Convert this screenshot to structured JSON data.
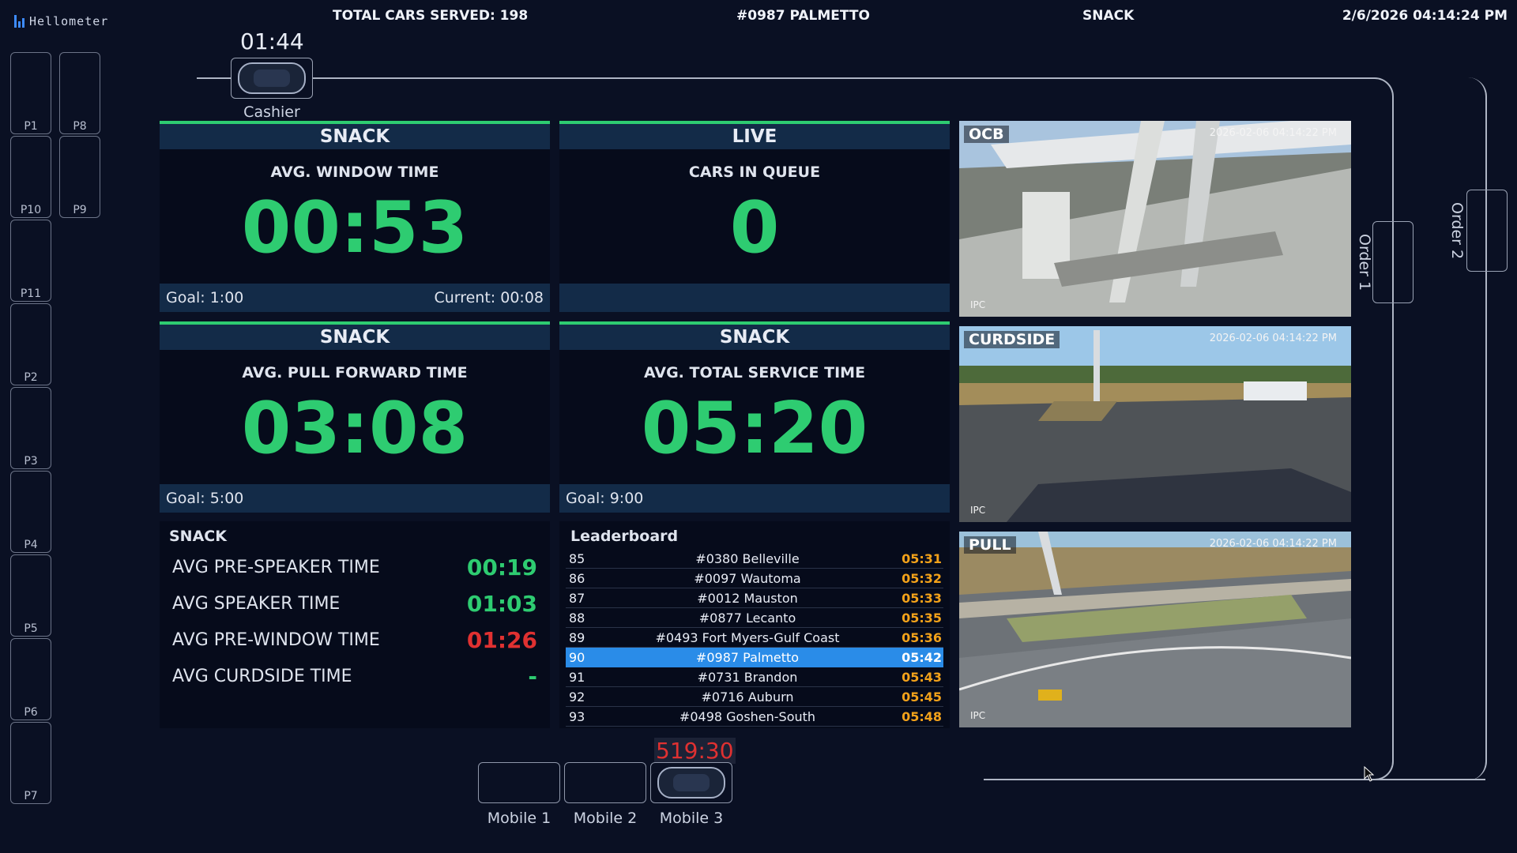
{
  "brand": "Hellometer",
  "header": {
    "total_cars": "TOTAL CARS SERVED: 198",
    "store": "#0987 PALMETTO",
    "daypart": "SNACK",
    "datetime": "2/6/2026 04:14:24 PM"
  },
  "slots": [
    "P1",
    "P8",
    "P10",
    "P9",
    "P11",
    "P2",
    "P3",
    "P4",
    "P5",
    "P6",
    "P7"
  ],
  "cashier": {
    "timer": "01:44",
    "label": "Cashier Window"
  },
  "panels": {
    "window": {
      "head": "SNACK",
      "sub": "AVG. WINDOW TIME",
      "value": "00:53",
      "goal": "Goal: 1:00",
      "current": "Current: 00:08"
    },
    "live": {
      "head": "LIVE",
      "sub": "CARS IN QUEUE",
      "value": "0"
    },
    "pull": {
      "head": "SNACK",
      "sub": "AVG. PULL FORWARD TIME",
      "value": "03:08",
      "goal": "Goal: 5:00"
    },
    "total": {
      "head": "SNACK",
      "sub": "AVG. TOTAL SERVICE TIME",
      "value": "05:20",
      "goal": "Goal: 9:00"
    }
  },
  "snack": {
    "title": "SNACK",
    "rows": [
      {
        "label": "AVG PRE-SPEAKER TIME",
        "value": "00:19",
        "color": "#2ecc71"
      },
      {
        "label": "AVG SPEAKER TIME",
        "value": "01:03",
        "color": "#2ecc71"
      },
      {
        "label": "AVG PRE-WINDOW TIME",
        "value": "01:26",
        "color": "#e03131"
      },
      {
        "label": "AVG CURDSIDE TIME",
        "value": "-",
        "color": "#2ecc71"
      }
    ]
  },
  "leaderboard": {
    "title": "Leaderboard",
    "rows": [
      {
        "rank": "85",
        "name": "#0380 Belleville",
        "time": "05:31"
      },
      {
        "rank": "86",
        "name": "#0097 Wautoma",
        "time": "05:32"
      },
      {
        "rank": "87",
        "name": "#0012 Mauston",
        "time": "05:33"
      },
      {
        "rank": "88",
        "name": "#0877 Lecanto",
        "time": "05:35"
      },
      {
        "rank": "89",
        "name": "#0493 Fort Myers-Gulf Coast",
        "time": "05:36"
      },
      {
        "rank": "90",
        "name": "#0987 Palmetto",
        "time": "05:42",
        "highlight": true
      },
      {
        "rank": "91",
        "name": "#0731 Brandon",
        "time": "05:43"
      },
      {
        "rank": "92",
        "name": "#0716 Auburn",
        "time": "05:45"
      },
      {
        "rank": "93",
        "name": "#0498 Goshen-South",
        "time": "05:48"
      }
    ]
  },
  "cameras": [
    {
      "label": "OCB",
      "timestamp": "2026-02-06 04:14:22 PM",
      "tag": "IPC"
    },
    {
      "label": "CURDSIDE",
      "timestamp": "2026-02-06 04:14:22 PM",
      "tag": "IPC"
    },
    {
      "label": "PULL",
      "timestamp": "2026-02-06 04:14:22 PM",
      "tag": "IPC"
    }
  ],
  "order_lanes": [
    "Order 1",
    "Order 2"
  ],
  "mobile": {
    "timer": "519:30",
    "labels": [
      "Mobile 1",
      "Mobile 2",
      "Mobile 3"
    ]
  },
  "colors": {
    "accent_green": "#2ecc71",
    "alert_red": "#e03131",
    "leader_orange": "#f3a21a",
    "highlight_blue": "#2a8ce8"
  }
}
